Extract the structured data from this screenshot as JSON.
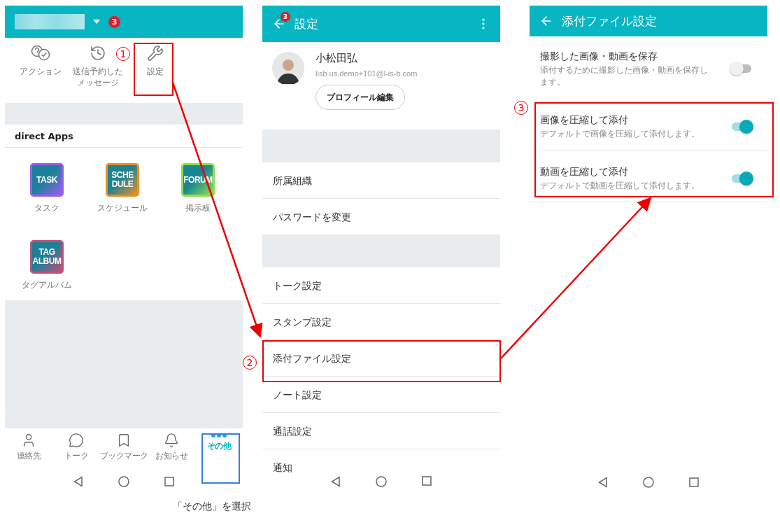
{
  "home_screen": {
    "header": {
      "badge": "3"
    },
    "actions": [
      {
        "kind": "help",
        "label_lines": [
          "アクション"
        ]
      },
      {
        "kind": "scheduled",
        "label_lines": [
          "送信予約した",
          "メッセージ"
        ]
      },
      {
        "kind": "settings",
        "label_lines": [
          "設定"
        ]
      }
    ],
    "apps_title": "direct Apps",
    "apps": [
      {
        "tile": "TASK",
        "label": "タスク",
        "color": "#9b5cf0"
      },
      {
        "tile": "SCHE DULE",
        "label": "スケジュール",
        "color": "#e8902a"
      },
      {
        "tile": "FORUM",
        "label": "掲示板",
        "color": "#8ee04a"
      },
      {
        "tile": "TAG ALBUM",
        "label": "タグアルバム",
        "color": "#c0507a"
      }
    ],
    "bottom_nav": [
      {
        "kind": "contacts",
        "label": "連絡先",
        "selected": false
      },
      {
        "kind": "talk",
        "label": "トーク",
        "selected": false
      },
      {
        "kind": "bookmark",
        "label": "ブックマーク",
        "selected": false
      },
      {
        "kind": "notice",
        "label": "お知らせ",
        "selected": false
      },
      {
        "kind": "more",
        "label": "その他",
        "selected": true
      }
    ]
  },
  "settings_screen": {
    "title": "設定",
    "back_badge": "3",
    "profile": {
      "name": "小松田弘",
      "email": "lisb.us.demo+101@l-is-b.com",
      "edit_button": "プロフィール編集"
    },
    "groups": [
      {
        "items": [
          "所属組織",
          "パスワードを変更"
        ]
      },
      {
        "items": [
          "トーク設定",
          "スタンプ設定",
          "添付ファイル設定",
          "ノート設定",
          "通話設定",
          "通知"
        ]
      }
    ]
  },
  "attachment_screen": {
    "title": "添付ファイル設定",
    "options": [
      {
        "title": "撮影した画像・動画を保存",
        "description": "添付するために撮影した画像・動画を保存します。",
        "on": false
      },
      {
        "title": "画像を圧縮して添付",
        "description": "デフォルトで画像を圧縮して添付します。",
        "on": true
      },
      {
        "title": "動画を圧縮して添付",
        "description": "デフォルトで動画を圧縮して添付します。",
        "on": true
      }
    ]
  },
  "annotations": {
    "steps": [
      "1",
      "2",
      "3"
    ],
    "caption": "「その他」を選択"
  }
}
